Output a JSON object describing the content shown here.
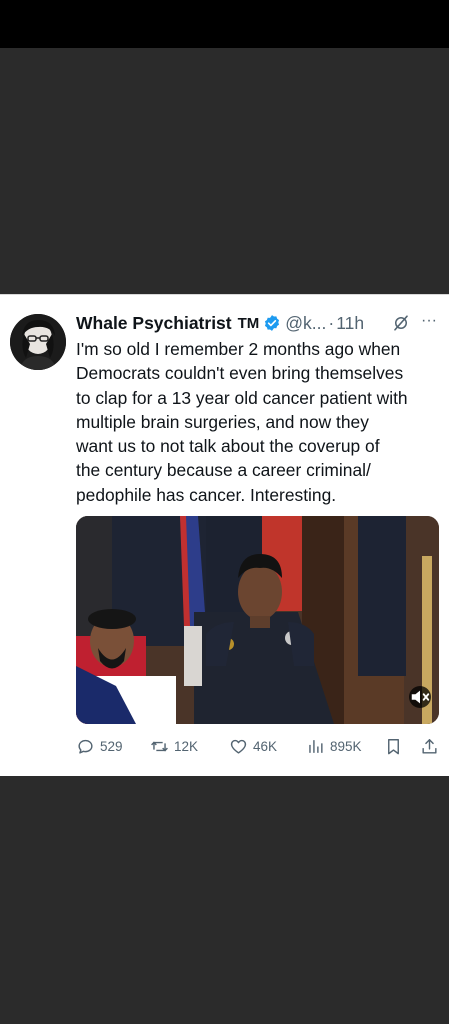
{
  "tweet": {
    "display_name": "Whale Psychiatrist",
    "tm": "TM",
    "handle": "@k...",
    "separator": "·",
    "time": "11h",
    "more": "···",
    "text": "I'm so old I remember 2 months ago when\nDemocrats couldn't even bring themselves\nto clap for a 13 year old cancer patient with\nmultiple brain surgeries, and now they\nwant us to not talk about the coverup of\nthe century because a career criminal/\npedophile has cancer. Interesting.",
    "icons": {
      "verified": "verified-badge-icon",
      "grok": "grok-icon",
      "more": "more-options-icon",
      "mute": "mute-icon"
    }
  },
  "actions": {
    "replies": "529",
    "reposts": "12K",
    "likes": "46K",
    "views": "895K"
  },
  "colors": {
    "text": "#0f1419",
    "muted": "#536471",
    "verified": "#1d9bf0",
    "background_dark": "#2b2b2b"
  }
}
